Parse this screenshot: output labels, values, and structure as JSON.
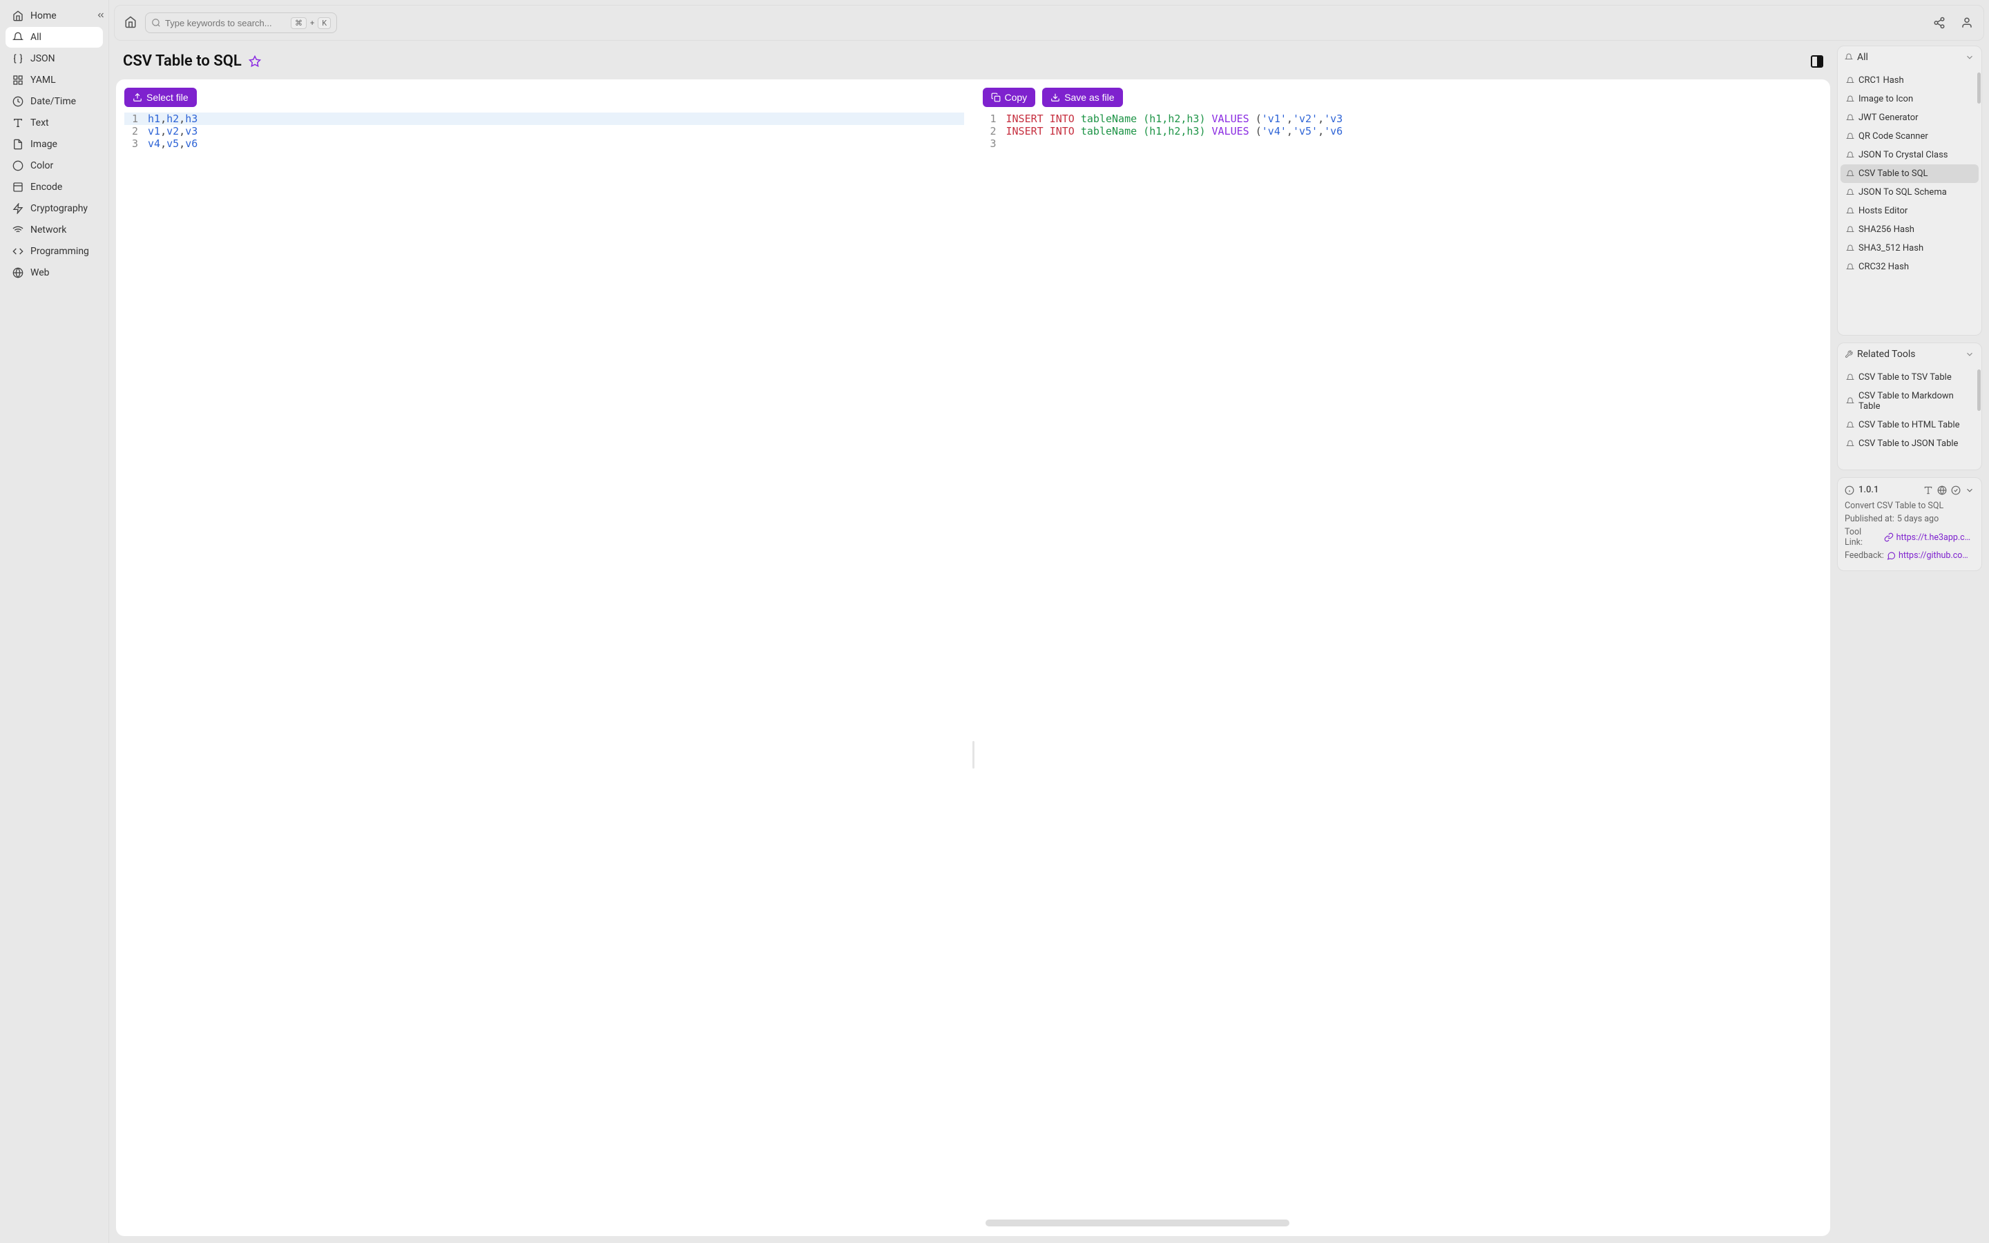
{
  "sidebar": {
    "items": [
      {
        "label": "Home",
        "icon": "home"
      },
      {
        "label": "All",
        "icon": "bell",
        "active": true
      },
      {
        "label": "JSON",
        "icon": "braces"
      },
      {
        "label": "YAML",
        "icon": "grid"
      },
      {
        "label": "Date/Time",
        "icon": "clock"
      },
      {
        "label": "Text",
        "icon": "text"
      },
      {
        "label": "Image",
        "icon": "file"
      },
      {
        "label": "Color",
        "icon": "palette"
      },
      {
        "label": "Encode",
        "icon": "box"
      },
      {
        "label": "Cryptography",
        "icon": "bolt"
      },
      {
        "label": "Network",
        "icon": "wifi"
      },
      {
        "label": "Programming",
        "icon": "code"
      },
      {
        "label": "Web",
        "icon": "globe"
      }
    ]
  },
  "search": {
    "placeholder": "Type keywords to search...",
    "k1": "⌘",
    "plus": "+",
    "k2": "K"
  },
  "page": {
    "title": "CSV Table to SQL"
  },
  "buttons": {
    "select_file": "Select file",
    "copy": "Copy",
    "save_as_file": "Save as file"
  },
  "editor_left": {
    "lines": [
      {
        "n": "1",
        "tokens": [
          [
            "id",
            "h1"
          ],
          [
            "pn",
            ","
          ],
          [
            "id",
            "h2"
          ],
          [
            "pn",
            ","
          ],
          [
            "id",
            "h3"
          ]
        ],
        "hl": true
      },
      {
        "n": "2",
        "tokens": [
          [
            "id",
            "v1"
          ],
          [
            "pn",
            ","
          ],
          [
            "id",
            "v2"
          ],
          [
            "pn",
            ","
          ],
          [
            "id",
            "v3"
          ]
        ]
      },
      {
        "n": "3",
        "tokens": [
          [
            "id",
            "v4"
          ],
          [
            "pn",
            ","
          ],
          [
            "id",
            "v5"
          ],
          [
            "pn",
            ","
          ],
          [
            "id",
            "v6"
          ]
        ]
      }
    ]
  },
  "editor_right": {
    "lines": [
      {
        "n": "1",
        "tokens": [
          [
            "kw",
            "INSERT"
          ],
          [
            "pn",
            " "
          ],
          [
            "kw",
            "INTO"
          ],
          [
            "pn",
            " "
          ],
          [
            "nm",
            "tableName"
          ],
          [
            "pn",
            " "
          ],
          [
            "nm",
            "("
          ],
          [
            "nm",
            "h1"
          ],
          [
            "nm",
            ","
          ],
          [
            "nm",
            "h2"
          ],
          [
            "nm",
            ","
          ],
          [
            "nm",
            "h3"
          ],
          [
            "nm",
            ")"
          ],
          [
            "pn",
            " "
          ],
          [
            "vl",
            "VALUES"
          ],
          [
            "pn",
            " ("
          ],
          [
            "id",
            "'v1'"
          ],
          [
            "pn",
            ","
          ],
          [
            "id",
            "'v2'"
          ],
          [
            "pn",
            ","
          ],
          [
            "id",
            "'v3"
          ]
        ]
      },
      {
        "n": "2",
        "tokens": [
          [
            "kw",
            "INSERT"
          ],
          [
            "pn",
            " "
          ],
          [
            "kw",
            "INTO"
          ],
          [
            "pn",
            " "
          ],
          [
            "nm",
            "tableName"
          ],
          [
            "pn",
            " "
          ],
          [
            "nm",
            "("
          ],
          [
            "nm",
            "h1"
          ],
          [
            "nm",
            ","
          ],
          [
            "nm",
            "h2"
          ],
          [
            "nm",
            ","
          ],
          [
            "nm",
            "h3"
          ],
          [
            "nm",
            ")"
          ],
          [
            "pn",
            " "
          ],
          [
            "vl",
            "VALUES"
          ],
          [
            "pn",
            " ("
          ],
          [
            "id",
            "'v4'"
          ],
          [
            "pn",
            ","
          ],
          [
            "id",
            "'v5'"
          ],
          [
            "pn",
            ","
          ],
          [
            "id",
            "'v6"
          ]
        ]
      },
      {
        "n": "3",
        "tokens": []
      }
    ]
  },
  "right": {
    "all_label": "All",
    "all_items": [
      "CRC1 Hash",
      "Image to Icon",
      "JWT Generator",
      "QR Code Scanner",
      "JSON To Crystal Class",
      "CSV Table to SQL",
      "JSON To SQL Schema",
      "Hosts Editor",
      "SHA256 Hash",
      "SHA3_512 Hash",
      "CRC32 Hash"
    ],
    "all_selected": "CSV Table to SQL",
    "related_label": "Related Tools",
    "related_items": [
      "CSV Table to TSV Table",
      "CSV Table to Markdown Table",
      "CSV Table to HTML Table",
      "CSV Table to JSON Table"
    ]
  },
  "info": {
    "version": "1.0.1",
    "desc": "Convert CSV Table to SQL",
    "published_label": "Published at:",
    "published_value": "5 days ago",
    "tool_link_label": "Tool Link:",
    "tool_link_value": "https://t.he3app.co…",
    "feedback_label": "Feedback:",
    "feedback_value": "https://github.com/…"
  }
}
